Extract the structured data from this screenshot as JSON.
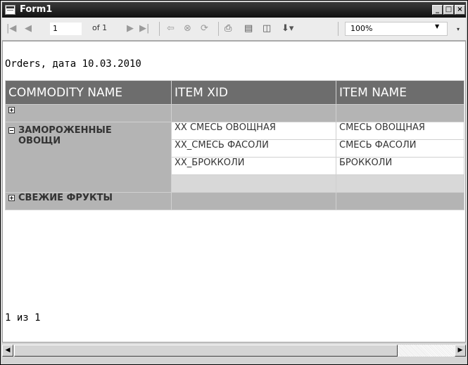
{
  "window": {
    "title": "Form1",
    "minimize_glyph": "_",
    "maximize_glyph": "□",
    "close_glyph": "×"
  },
  "toolbar": {
    "first_page_icon": "first-page-icon",
    "prev_page_icon": "previous-page-icon",
    "current_page": "1",
    "of_label": "of 1",
    "next_page_icon": "next-page-icon",
    "last_page_icon": "last-page-icon",
    "back_icon": "back-icon",
    "stop_icon": "stop-icon",
    "refresh_icon": "refresh-icon",
    "print_icon": "print-icon",
    "print_layout_icon": "print-layout-icon",
    "page_setup_icon": "page-setup-icon",
    "export_icon": "export-icon",
    "zoom": "100%"
  },
  "report": {
    "title": "Orders, дата 10.03.2010",
    "headers": [
      "COMMODITY NAME",
      "ITEM XID",
      "ITEM NAME"
    ],
    "groups": [
      {
        "name": "",
        "expanded": false
      },
      {
        "name_line1": "ЗАМОРОЖЕННЫЕ",
        "name_line2": "ОВОЩИ",
        "expanded": true,
        "items": [
          {
            "xid": "XX СМЕСЬ ОВОЩНАЯ",
            "name": "СМЕСЬ ОВОЩНАЯ"
          },
          {
            "xid": "XX_СМЕСЬ ФАСОЛИ",
            "name": "СМЕСЬ ФАСОЛИ"
          },
          {
            "xid": "XX_БРОККОЛИ",
            "name": "БРОККОЛИ"
          }
        ]
      },
      {
        "name": "СВЕЖИЕ ФРУКТЫ",
        "expanded": false
      }
    ],
    "page_footer": "1 из 1"
  },
  "colors": {
    "header_bg": "#6d6d6d",
    "group_bg": "#b4b4b4",
    "titlebar": "#111111"
  }
}
